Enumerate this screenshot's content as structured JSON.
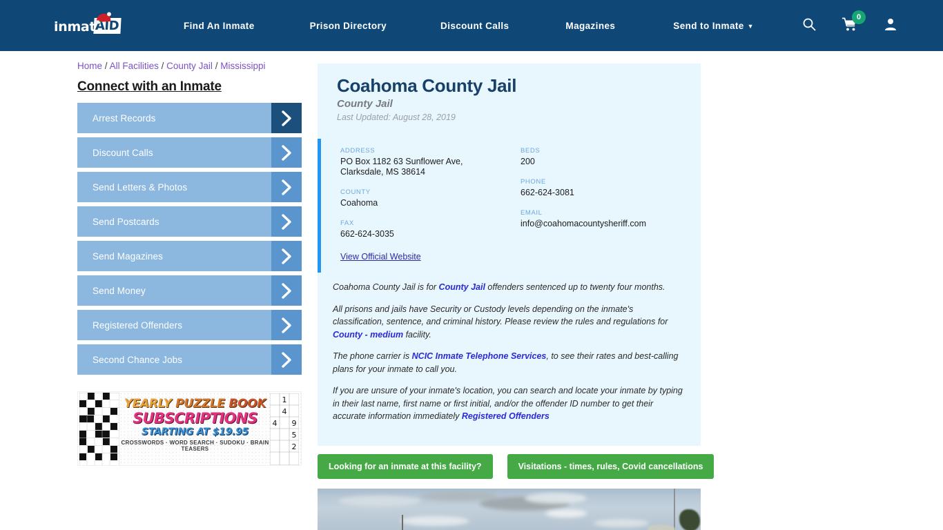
{
  "header": {
    "logo": {
      "text": "inmate",
      "badge": "AID",
      "icon": "santa-hat-icon"
    },
    "nav": [
      {
        "label": "Find An Inmate",
        "has_caret": false
      },
      {
        "label": "Prison Directory",
        "has_caret": false
      },
      {
        "label": "Discount Calls",
        "has_caret": false
      },
      {
        "label": "Magazines",
        "has_caret": false
      },
      {
        "label": "Send to Inmate",
        "has_caret": true
      }
    ],
    "icons": {
      "search": "search-icon",
      "cart": "cart-icon",
      "cart_count": "0",
      "account": "user-account-icon"
    },
    "background_color": "#0f4876",
    "cart_badge_color": "#17a673"
  },
  "breadcrumb": {
    "items": [
      "Home",
      "All Facilities",
      "County Jail",
      "Mississippi"
    ],
    "separator": "/",
    "link_color": "#7b52c4"
  },
  "sidebar": {
    "title": "Connect with an Inmate",
    "items": [
      {
        "label": "Arrest Records",
        "active": true
      },
      {
        "label": "Discount Calls",
        "active": false
      },
      {
        "label": "Send Letters & Photos",
        "active": false
      },
      {
        "label": "Send Postcards",
        "active": false
      },
      {
        "label": "Send Magazines",
        "active": false
      },
      {
        "label": "Send Money",
        "active": false
      },
      {
        "label": "Registered Offenders",
        "active": false
      },
      {
        "label": "Second Chance Jobs",
        "active": false
      }
    ],
    "button_color": "#8cb8e0",
    "arrow_color": "#5b95cd",
    "active_arrow_color": "#1d4f7c"
  },
  "ad": {
    "line1_word1": "YEARLY",
    "line1_word2": "PUZZLE",
    "line1_word3": "BOOK",
    "line2": "SUBSCRIPTIONS",
    "line3": "STARTING AT $19.95",
    "line4": "CROSSWORDS · WORD SEARCH · SUDOKU · BRAIN TEASERS",
    "sudoku_digits": [
      "1",
      "4",
      "4",
      "9",
      "5",
      "2"
    ]
  },
  "facility": {
    "name": "Coahoma County Jail",
    "type": "County Jail",
    "last_updated": "Last Updated: August 28, 2019",
    "info": {
      "address_label": "ADDRESS",
      "address_line1": "PO Box 1182 63 Sunflower Ave,",
      "address_line2": "Clarksdale, MS 38614",
      "beds_label": "BEDS",
      "beds_value": "200",
      "county_label": "COUNTY",
      "county_value": "Coahoma",
      "phone_label": "PHONE",
      "phone_value": "662-624-3081",
      "fax_label": "FAX",
      "fax_value": "662-624-3035",
      "email_label": "EMAIL",
      "email_value": "info@coahomacountysheriff.com",
      "website_link": "View Official Website"
    },
    "paragraphs": [
      {
        "parts": [
          {
            "t": "Coahoma County Jail is for ",
            "link": false
          },
          {
            "t": "County Jail",
            "link": true
          },
          {
            "t": " offenders sentenced up to twenty four months.",
            "link": false
          }
        ]
      },
      {
        "parts": [
          {
            "t": "All prisons and jails have Security or Custody levels depending on the inmate's classification, sentence, and criminal history. Please review the rules and regulations for ",
            "link": false
          },
          {
            "t": "County - medium",
            "link": true
          },
          {
            "t": " facility.",
            "link": false
          }
        ]
      },
      {
        "parts": [
          {
            "t": "The phone carrier is ",
            "link": false
          },
          {
            "t": "NCIC Inmate Telephone Services",
            "link": true
          },
          {
            "t": ", to see their rates and best-calling plans for your inmate to call you.",
            "link": false
          }
        ]
      },
      {
        "parts": [
          {
            "t": "If you are unsure of your inmate's location, you can search and locate your inmate by typing in their last name, first name or first initial, and/or the offender ID number to get their accurate information immediately ",
            "link": false
          },
          {
            "t": "Registered Offenders",
            "link": true
          }
        ]
      }
    ],
    "cta": [
      {
        "label": "Looking for an inmate at this facility?"
      },
      {
        "label": "Visitations - times, rules, Covid cancellations"
      }
    ],
    "card_background": "#e8f6fd",
    "accent_bar_color": "#2196f3",
    "cta_color": "#45a945"
  }
}
